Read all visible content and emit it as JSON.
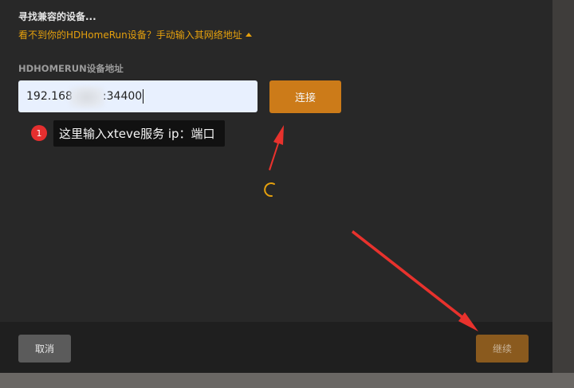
{
  "dialog": {
    "title": "寻找兼容的设备...",
    "manual_link": "看不到你的HDHomeRun设备？手动输入其网络地址",
    "manual_link_icon": "caret-up-icon",
    "accent_color": "#e5a00d"
  },
  "address": {
    "label": "HDHOMERUN设备地址",
    "prefix": "192.168",
    "suffix": ":34400"
  },
  "buttons": {
    "connect": "连接",
    "cancel": "取消",
    "continue": "继续"
  },
  "annotation": {
    "badge": "1",
    "text": "这里输入xteve服务 ip：端口",
    "arrow_color": "#e8322d"
  },
  "status": {
    "spinner_icon": "loading-spinner-icon"
  }
}
